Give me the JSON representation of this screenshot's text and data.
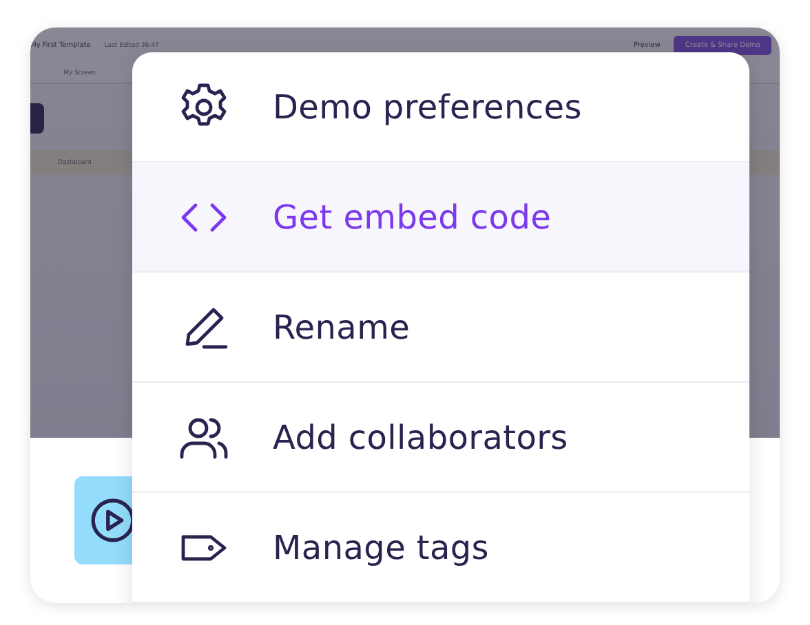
{
  "preview": {
    "title": "My First Template",
    "status": "Last Edited 36:47",
    "preview_label": "Preview",
    "share_button": "Create & Share Demo",
    "screen_selector": "My Screen",
    "nav_item": "Dashboard"
  },
  "menu": {
    "items": [
      {
        "label": "Demo preferences",
        "selected": false
      },
      {
        "label": "Get embed code",
        "selected": true
      },
      {
        "label": "Rename",
        "selected": false
      },
      {
        "label": "Add collaborators",
        "selected": false
      },
      {
        "label": "Manage tags",
        "selected": false
      }
    ]
  }
}
